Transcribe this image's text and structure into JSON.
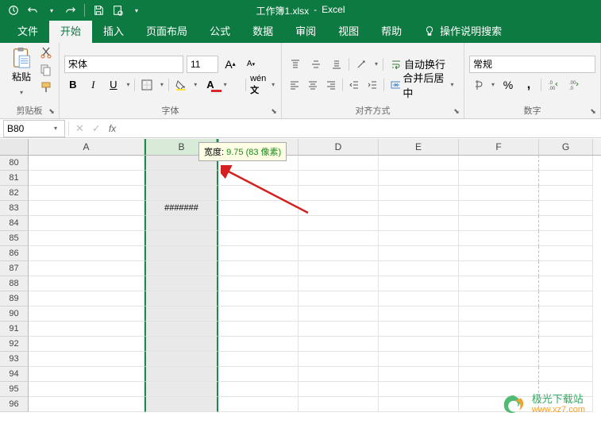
{
  "titlebar": {
    "filename": "工作簿1.xlsx",
    "sep": "-",
    "appname": "Excel"
  },
  "tabs": {
    "file": "文件",
    "home": "开始",
    "insert": "插入",
    "layout": "页面布局",
    "formula": "公式",
    "data": "数据",
    "review": "审阅",
    "view": "视图",
    "help": "帮助",
    "tellme": "操作说明搜索"
  },
  "ribbon": {
    "clipboard": {
      "label": "剪贴板",
      "paste": "粘贴"
    },
    "font": {
      "label": "字体",
      "name": "宋体",
      "size": "11",
      "bold": "B",
      "italic": "I",
      "underline": "U"
    },
    "align": {
      "label": "对齐方式",
      "wrap": "自动换行",
      "merge": "合并后居中"
    },
    "number": {
      "label": "数字",
      "format": "常规"
    }
  },
  "namebox": "B80",
  "tooltip": {
    "label": "宽度: ",
    "val": "9.75 (83 像素)"
  },
  "cols": [
    "A",
    "B",
    "C",
    "D",
    "E",
    "F",
    "G"
  ],
  "rows": [
    "80",
    "81",
    "82",
    "83",
    "84",
    "85",
    "86",
    "87",
    "88",
    "89",
    "90",
    "91",
    "92",
    "93",
    "94",
    "95",
    "96"
  ],
  "cell_b83": "#######",
  "watermark": {
    "name": "极光下载站",
    "url": "www.xz7.com"
  }
}
